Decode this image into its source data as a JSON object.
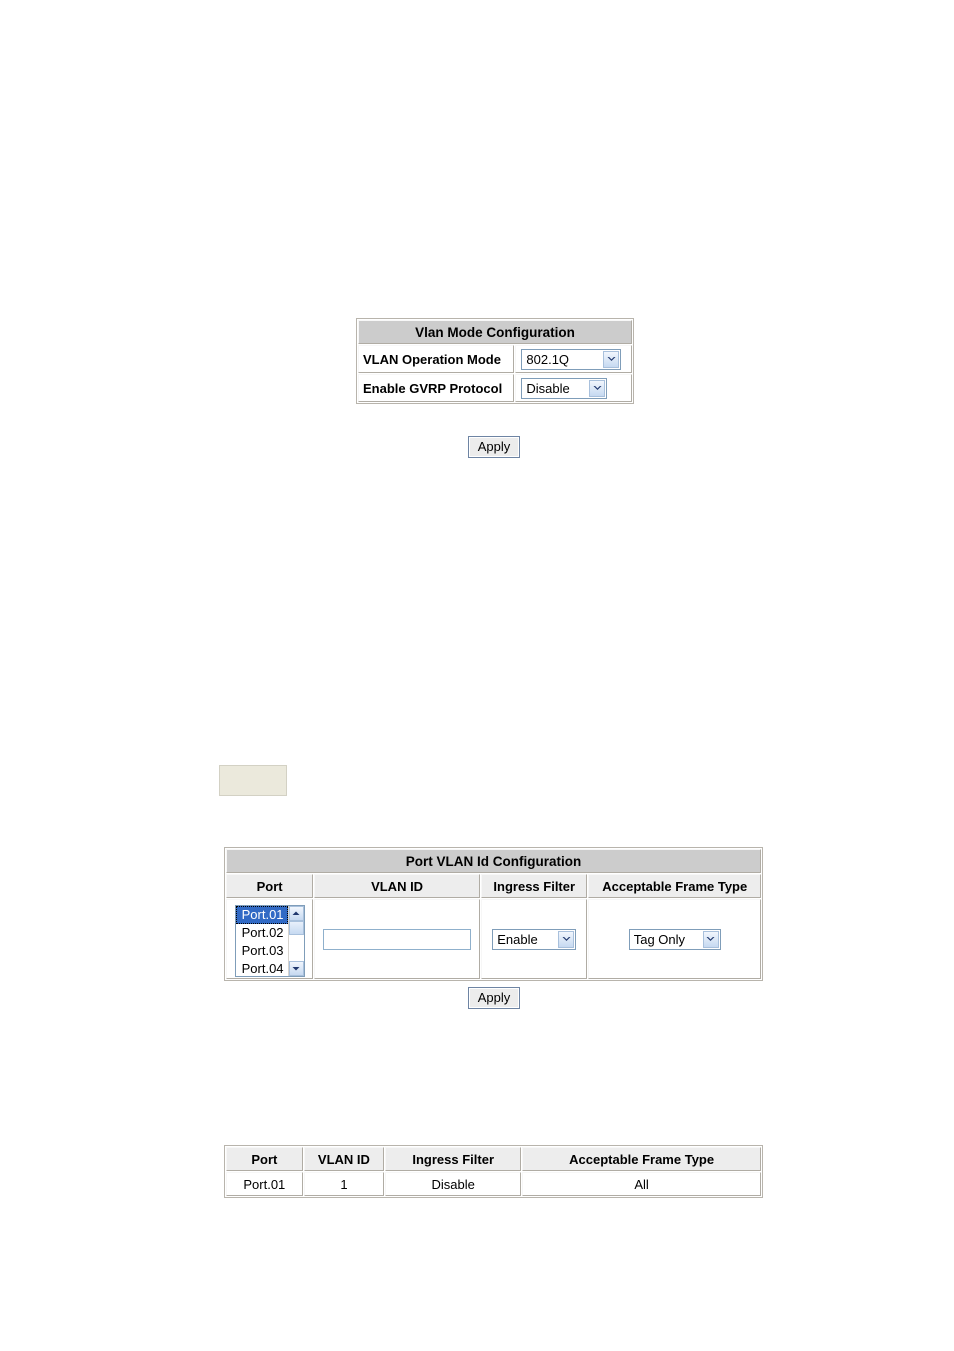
{
  "page": {
    "background": "#ffffff",
    "title_bar_color": "#cccccc",
    "header_color": "#ededed",
    "selection_color": "#316ac5",
    "note_box_color": "#ebe9dc"
  },
  "vlan_mode": {
    "title": "Vlan Mode Configuration",
    "rows": [
      {
        "label": "VLAN Operation Mode",
        "value": "802.1Q",
        "control": "select",
        "icon": "chevron-down-icon"
      },
      {
        "label": "Enable GVRP Protocol",
        "value": "Disable",
        "control": "select",
        "icon": "chevron-down-icon"
      }
    ],
    "apply_label": "Apply"
  },
  "note_box": {
    "text": ""
  },
  "port_vlan": {
    "title": "Port VLAN Id Configuration",
    "columns": [
      "Port",
      "VLAN ID",
      "Ingress Filter",
      "Acceptable Frame Type"
    ],
    "port_list": {
      "items": [
        "Port.01",
        "Port.02",
        "Port.03",
        "Port.04"
      ],
      "selected": "Port.01",
      "scroll_up_icon": "chevron-up-icon",
      "scroll_down_icon": "chevron-down-icon"
    },
    "vlan_id_input": {
      "value": "",
      "placeholder": ""
    },
    "ingress_filter": {
      "value": "Enable",
      "icon": "chevron-down-icon"
    },
    "acceptable_frame_type": {
      "value": "Tag Only",
      "icon": "chevron-down-icon"
    },
    "apply_label": "Apply"
  },
  "port_vlan_status": {
    "columns": [
      "Port",
      "VLAN ID",
      "Ingress Filter",
      "Acceptable Frame Type"
    ],
    "rows": [
      {
        "port": "Port.01",
        "vlan_id": "1",
        "ingress_filter": "Disable",
        "acceptable_frame_type": "All"
      }
    ]
  }
}
